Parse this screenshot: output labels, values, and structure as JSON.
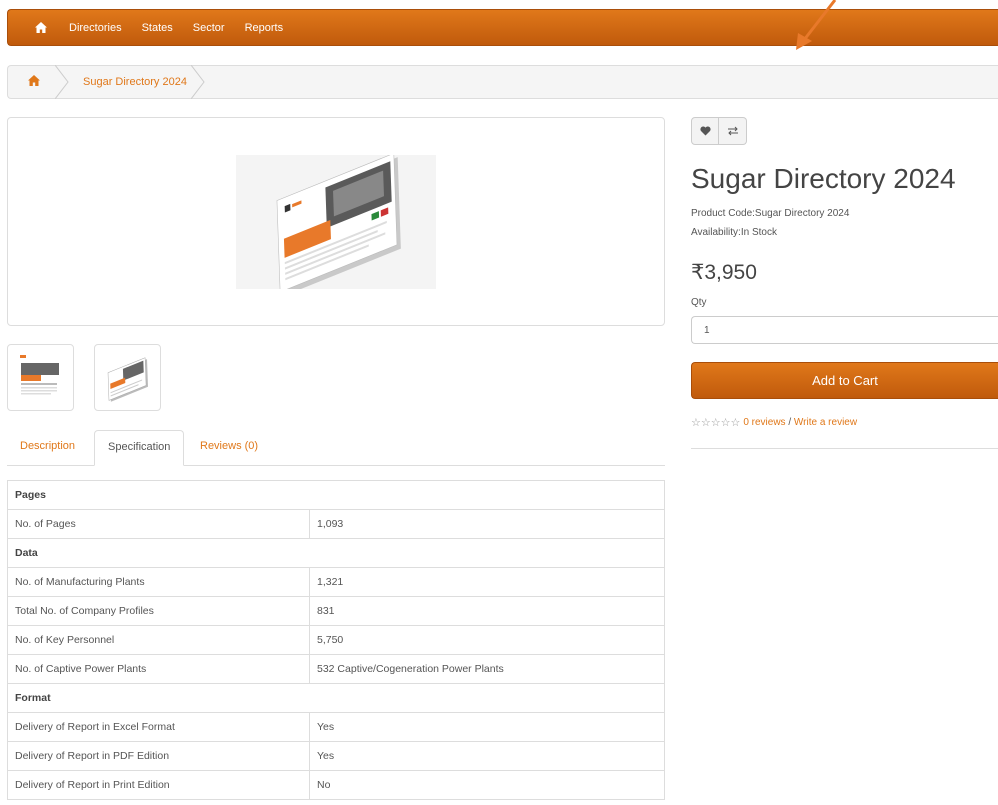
{
  "nav": {
    "items": [
      "Directories",
      "States",
      "Sector",
      "Reports"
    ]
  },
  "breadcrumb": {
    "current": "Sugar Directory 2024"
  },
  "tabs": [
    "Description",
    "Specification",
    "Reviews (0)"
  ],
  "spec": {
    "sections": [
      {
        "title": "Pages",
        "rows": [
          [
            "No. of Pages",
            "1,093"
          ]
        ]
      },
      {
        "title": "Data",
        "rows": [
          [
            "No. of Manufacturing Plants",
            "1,321"
          ],
          [
            "Total No. of Company Profiles",
            "831"
          ],
          [
            "No. of Key Personnel",
            "5,750"
          ],
          [
            "No. of Captive Power Plants",
            "532 Captive/Cogeneration Power Plants"
          ]
        ]
      },
      {
        "title": "Format",
        "rows": [
          [
            "Delivery of Report in Excel Format",
            "Yes"
          ],
          [
            "Delivery of Report in PDF Edition",
            "Yes"
          ],
          [
            "Delivery of Report in Print Edition",
            "No"
          ]
        ]
      }
    ]
  },
  "product": {
    "title": "Sugar Directory 2024",
    "code": "Product Code:Sugar Directory 2024",
    "availability": "Availability:In Stock",
    "price": "₹3,950",
    "qty_label": "Qty",
    "qty_value": "1",
    "cart_label": "Add to Cart",
    "stars": "☆☆☆☆☆",
    "reviews_link": "0 reviews",
    "review_sep": " / ",
    "write_review": "Write a review"
  },
  "colors": {
    "accent": "#e0781a",
    "accent_dark": "#c05a0c"
  }
}
